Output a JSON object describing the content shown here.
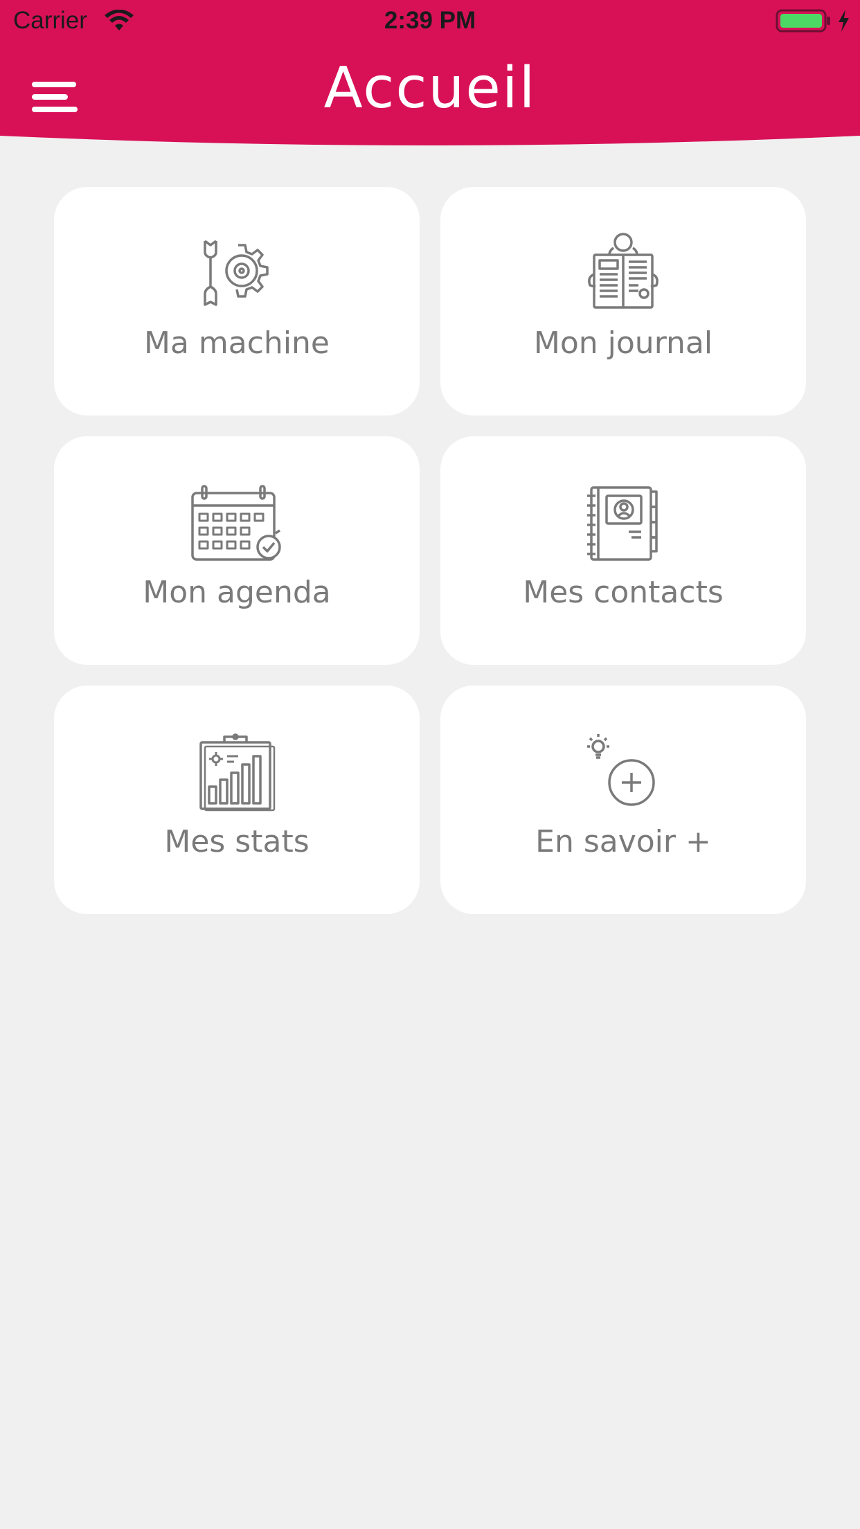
{
  "status_bar": {
    "carrier": "Carrier",
    "time": "2:39 PM"
  },
  "header": {
    "title": "Accueil",
    "background_color": "#d81157"
  },
  "menu": {
    "icon": "hamburger-menu-icon"
  },
  "tiles": [
    {
      "label": "Ma machine",
      "icon": "gear-wrench-icon"
    },
    {
      "label": "Mon journal",
      "icon": "newspaper-icon"
    },
    {
      "label": "Mon agenda",
      "icon": "calendar-check-icon"
    },
    {
      "label": "Mes contacts",
      "icon": "address-book-icon"
    },
    {
      "label": "Mes stats",
      "icon": "bar-chart-clipboard-icon"
    },
    {
      "label": "En savoir +",
      "icon": "lightbulb-plus-icon"
    }
  ],
  "colors": {
    "accent": "#d81157",
    "background": "#f0f0f0",
    "tile": "#ffffff",
    "icon_gray": "#7a7a7a",
    "battery_green": "#4cd964"
  }
}
